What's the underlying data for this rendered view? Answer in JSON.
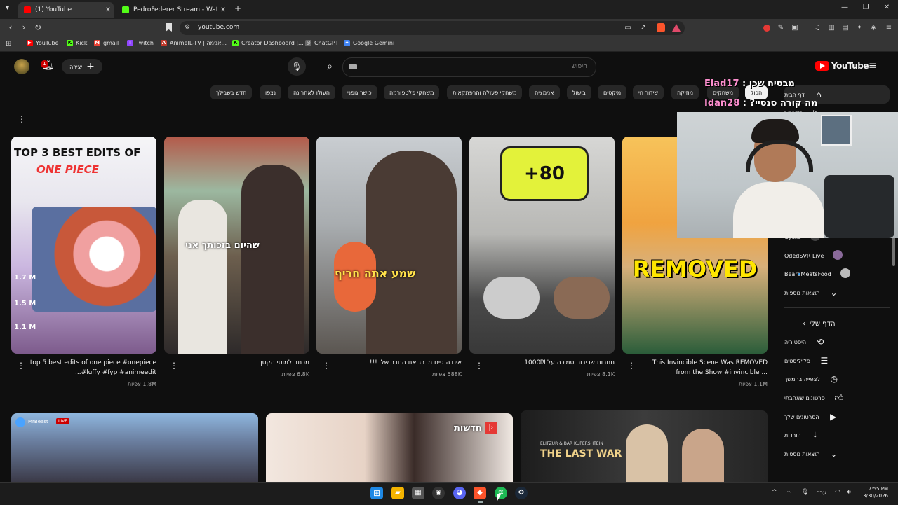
{
  "browser": {
    "tabs": [
      {
        "label": "(1) YouTube",
        "active": true,
        "color": "#ff0000"
      },
      {
        "label": "PedroFederer Stream - Watch Live on Kick",
        "active": false,
        "color": "#53fc18"
      }
    ],
    "url": "youtube.com",
    "bookmarks": [
      {
        "label": "YouTube",
        "color": "#ff0000",
        "icon": "youtube-icon"
      },
      {
        "label": "Kick",
        "color": "#53fc18",
        "icon": "kick-icon"
      },
      {
        "label": "gmail",
        "color": "#ea4335",
        "icon": "gmail-icon"
      },
      {
        "label": "Twitch",
        "color": "#9146ff",
        "icon": "twitch-icon"
      },
      {
        "label": "AnimeIL-TV | אנימה...",
        "color": "#c0392b",
        "icon": "anime-icon"
      },
      {
        "label": "Creator Dashboard |...",
        "color": "#53fc18",
        "icon": "kick-icon"
      },
      {
        "label": "ChatGPT",
        "color": "#888888",
        "icon": "chatgpt-icon"
      },
      {
        "label": "Google Gemini",
        "color": "#4285f4",
        "icon": "gemini-icon"
      }
    ]
  },
  "youtube": {
    "logo": "YouTube",
    "search_placeholder": "חיפוש",
    "create_label": "יצירה",
    "notification_count": "1",
    "chips": [
      "הכול",
      "משחקים",
      "מוזיקה",
      "שידור חי",
      "מיקסים",
      "בישול",
      "אנימציה",
      "משחקי פעולה והרפתקאות",
      "משחקי פלטפורמה",
      "כושר גופני",
      "העולו לאחרונה",
      "נצפו",
      "חדש בשבילך"
    ],
    "sidebar": {
      "top": [
        {
          "label": "דף הבית",
          "icon": "home-icon"
        },
        {
          "label": "Shorts",
          "icon": "shorts-icon"
        }
      ],
      "subs": [
        {
          "label": "Cyclic"
        },
        {
          "label": "OdedSVR Live"
        },
        {
          "label": "BeardMeatsFood"
        },
        {
          "label": "תוצאות נוספות"
        }
      ],
      "you_header": "הדף שלי",
      "you_items": [
        {
          "label": "היסטוריה",
          "icon": "history-icon"
        },
        {
          "label": "פלייליסטים",
          "icon": "playlist-icon"
        },
        {
          "label": "לצפייה בהמשך",
          "icon": "clock-icon"
        },
        {
          "label": "סרטונים שאהבתי",
          "icon": "like-icon"
        },
        {
          "label": "הסרטונים שלך",
          "icon": "video-icon"
        },
        {
          "label": "הורדות",
          "icon": "download-icon"
        },
        {
          "label": "תוצאות נוספות",
          "icon": "chevron-down-icon"
        }
      ]
    },
    "videos": [
      {
        "title": "top 5 best edits of one piece #onepiece #luffy #fyp #animeedit...",
        "views": "1.8M צפיות",
        "thumb_text": "TOP 3 BEST EDITS OF",
        "thumb_sub": "ONE PIECE",
        "thumb_stats": [
          "1.7 M",
          "1.5 M",
          "1.1 M"
        ]
      },
      {
        "title": "מכתב למוטי הקטן",
        "views": "6.8K צפיות",
        "thumb_text": "שהיום בזכותך אני"
      },
      {
        "title": "אינדה גיים מדרג את החדר שלי !!!",
        "views": "588K צפיות",
        "thumb_text": "שמע אתה חריף"
      },
      {
        "title": "תחרות שכיבות סמיכה על 1000₪",
        "views": "8.1K צפיות",
        "thumb_text": "+80"
      },
      {
        "title": "This Invincible Scene Was REMOVED from the Show #invincible ...",
        "views": "1.1M צפיות",
        "thumb_text": "REMOVED"
      }
    ],
    "row2": [
      {
        "thumb_text": "",
        "channel": "MrBeast",
        "badge": "LIVE"
      },
      {
        "thumb_text": "חדשות"
      },
      {
        "thumb_text": "ELITZUR & BAR KUPERSHTEIN",
        "thumb_sub": "THE LAST WAR"
      }
    ]
  },
  "stream_overlay": {
    "chat": [
      {
        "user": "Elad17",
        "msg": "מבטיח שכן"
      },
      {
        "user": "Idan28",
        "msg": "מה קורה סנסיי?"
      }
    ]
  },
  "taskbar": {
    "lang": "עבר",
    "time": "7:55 PM",
    "date": "3/30/2026"
  }
}
